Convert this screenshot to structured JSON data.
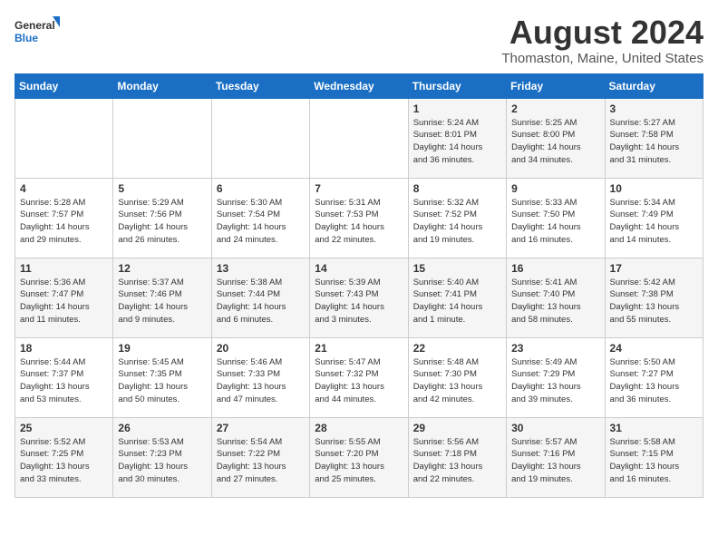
{
  "header": {
    "logo_general": "General",
    "logo_blue": "Blue",
    "month_year": "August 2024",
    "location": "Thomaston, Maine, United States"
  },
  "days_of_week": [
    "Sunday",
    "Monday",
    "Tuesday",
    "Wednesday",
    "Thursday",
    "Friday",
    "Saturday"
  ],
  "weeks": [
    [
      {
        "day": "",
        "info": ""
      },
      {
        "day": "",
        "info": ""
      },
      {
        "day": "",
        "info": ""
      },
      {
        "day": "",
        "info": ""
      },
      {
        "day": "1",
        "info": "Sunrise: 5:24 AM\nSunset: 8:01 PM\nDaylight: 14 hours\nand 36 minutes."
      },
      {
        "day": "2",
        "info": "Sunrise: 5:25 AM\nSunset: 8:00 PM\nDaylight: 14 hours\nand 34 minutes."
      },
      {
        "day": "3",
        "info": "Sunrise: 5:27 AM\nSunset: 7:58 PM\nDaylight: 14 hours\nand 31 minutes."
      }
    ],
    [
      {
        "day": "4",
        "info": "Sunrise: 5:28 AM\nSunset: 7:57 PM\nDaylight: 14 hours\nand 29 minutes."
      },
      {
        "day": "5",
        "info": "Sunrise: 5:29 AM\nSunset: 7:56 PM\nDaylight: 14 hours\nand 26 minutes."
      },
      {
        "day": "6",
        "info": "Sunrise: 5:30 AM\nSunset: 7:54 PM\nDaylight: 14 hours\nand 24 minutes."
      },
      {
        "day": "7",
        "info": "Sunrise: 5:31 AM\nSunset: 7:53 PM\nDaylight: 14 hours\nand 22 minutes."
      },
      {
        "day": "8",
        "info": "Sunrise: 5:32 AM\nSunset: 7:52 PM\nDaylight: 14 hours\nand 19 minutes."
      },
      {
        "day": "9",
        "info": "Sunrise: 5:33 AM\nSunset: 7:50 PM\nDaylight: 14 hours\nand 16 minutes."
      },
      {
        "day": "10",
        "info": "Sunrise: 5:34 AM\nSunset: 7:49 PM\nDaylight: 14 hours\nand 14 minutes."
      }
    ],
    [
      {
        "day": "11",
        "info": "Sunrise: 5:36 AM\nSunset: 7:47 PM\nDaylight: 14 hours\nand 11 minutes."
      },
      {
        "day": "12",
        "info": "Sunrise: 5:37 AM\nSunset: 7:46 PM\nDaylight: 14 hours\nand 9 minutes."
      },
      {
        "day": "13",
        "info": "Sunrise: 5:38 AM\nSunset: 7:44 PM\nDaylight: 14 hours\nand 6 minutes."
      },
      {
        "day": "14",
        "info": "Sunrise: 5:39 AM\nSunset: 7:43 PM\nDaylight: 14 hours\nand 3 minutes."
      },
      {
        "day": "15",
        "info": "Sunrise: 5:40 AM\nSunset: 7:41 PM\nDaylight: 14 hours\nand 1 minute."
      },
      {
        "day": "16",
        "info": "Sunrise: 5:41 AM\nSunset: 7:40 PM\nDaylight: 13 hours\nand 58 minutes."
      },
      {
        "day": "17",
        "info": "Sunrise: 5:42 AM\nSunset: 7:38 PM\nDaylight: 13 hours\nand 55 minutes."
      }
    ],
    [
      {
        "day": "18",
        "info": "Sunrise: 5:44 AM\nSunset: 7:37 PM\nDaylight: 13 hours\nand 53 minutes."
      },
      {
        "day": "19",
        "info": "Sunrise: 5:45 AM\nSunset: 7:35 PM\nDaylight: 13 hours\nand 50 minutes."
      },
      {
        "day": "20",
        "info": "Sunrise: 5:46 AM\nSunset: 7:33 PM\nDaylight: 13 hours\nand 47 minutes."
      },
      {
        "day": "21",
        "info": "Sunrise: 5:47 AM\nSunset: 7:32 PM\nDaylight: 13 hours\nand 44 minutes."
      },
      {
        "day": "22",
        "info": "Sunrise: 5:48 AM\nSunset: 7:30 PM\nDaylight: 13 hours\nand 42 minutes."
      },
      {
        "day": "23",
        "info": "Sunrise: 5:49 AM\nSunset: 7:29 PM\nDaylight: 13 hours\nand 39 minutes."
      },
      {
        "day": "24",
        "info": "Sunrise: 5:50 AM\nSunset: 7:27 PM\nDaylight: 13 hours\nand 36 minutes."
      }
    ],
    [
      {
        "day": "25",
        "info": "Sunrise: 5:52 AM\nSunset: 7:25 PM\nDaylight: 13 hours\nand 33 minutes."
      },
      {
        "day": "26",
        "info": "Sunrise: 5:53 AM\nSunset: 7:23 PM\nDaylight: 13 hours\nand 30 minutes."
      },
      {
        "day": "27",
        "info": "Sunrise: 5:54 AM\nSunset: 7:22 PM\nDaylight: 13 hours\nand 27 minutes."
      },
      {
        "day": "28",
        "info": "Sunrise: 5:55 AM\nSunset: 7:20 PM\nDaylight: 13 hours\nand 25 minutes."
      },
      {
        "day": "29",
        "info": "Sunrise: 5:56 AM\nSunset: 7:18 PM\nDaylight: 13 hours\nand 22 minutes."
      },
      {
        "day": "30",
        "info": "Sunrise: 5:57 AM\nSunset: 7:16 PM\nDaylight: 13 hours\nand 19 minutes."
      },
      {
        "day": "31",
        "info": "Sunrise: 5:58 AM\nSunset: 7:15 PM\nDaylight: 13 hours\nand 16 minutes."
      }
    ]
  ]
}
